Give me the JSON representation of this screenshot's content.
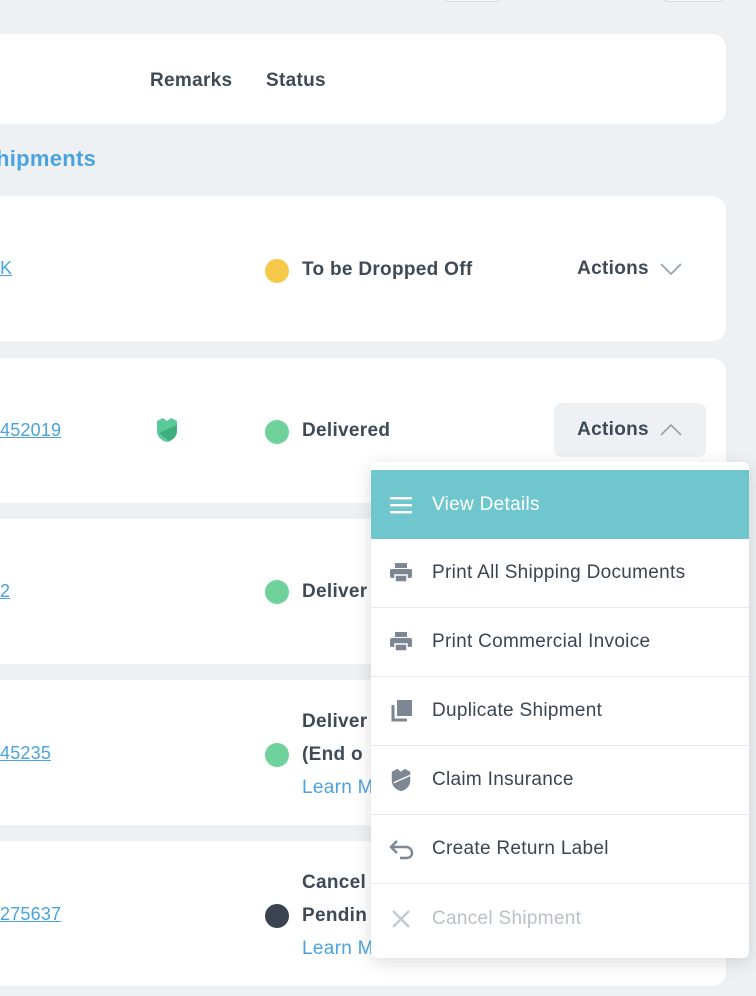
{
  "header": {
    "remarks_label": "Remarks",
    "status_label": "Status"
  },
  "section": {
    "title": "hipments"
  },
  "rows": [
    {
      "link": "K",
      "status": "To be Dropped Off",
      "status_color": "#f7c94b",
      "actions_label": "Actions"
    },
    {
      "link": "452019",
      "status": "Delivered",
      "status_color": "#6fd19b",
      "actions_label": "Actions"
    },
    {
      "link": "2",
      "status": "Deliver",
      "status_color": "#6fd19b"
    },
    {
      "link": "45235",
      "status_line1": "Deliver",
      "status_line2": "(End o",
      "learn": "Learn M",
      "status_color": "#6fd19b"
    },
    {
      "link": "275637",
      "status_line1": "Cancel",
      "status_line2": "Pendin",
      "learn": "Learn M",
      "status_color": "#3b4250"
    }
  ],
  "menu": {
    "items": [
      {
        "label": "View Details",
        "icon": "menu-lines-icon"
      },
      {
        "label": "Print All Shipping Documents",
        "icon": "printer-icon"
      },
      {
        "label": "Print Commercial Invoice",
        "icon": "printer-icon"
      },
      {
        "label": "Duplicate Shipment",
        "icon": "duplicate-icon"
      },
      {
        "label": "Claim Insurance",
        "icon": "shield-icon"
      },
      {
        "label": "Create Return Label",
        "icon": "return-arrow-icon"
      },
      {
        "label": "Cancel Shipment",
        "icon": "close-icon"
      }
    ]
  },
  "colors": {
    "accent": "#4aa3df",
    "menu_active": "#6fc7cd",
    "insured": "#59c99a"
  }
}
